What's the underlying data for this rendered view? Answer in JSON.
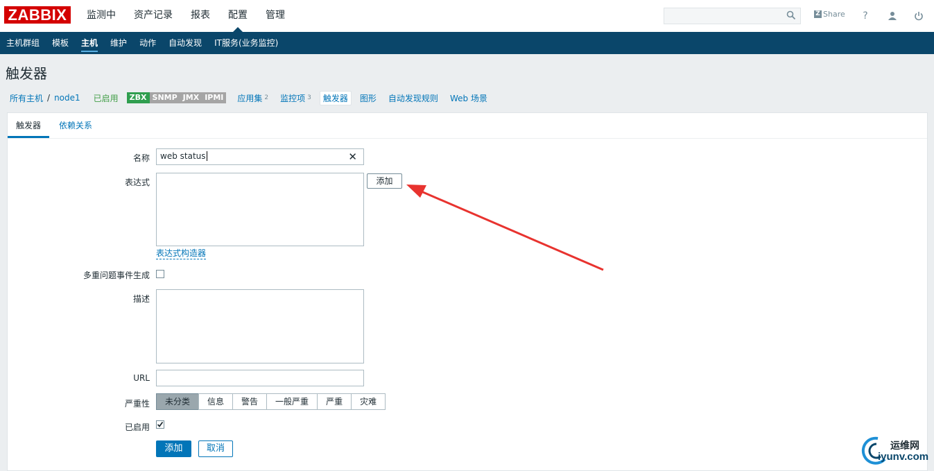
{
  "logo": "ZABBIX",
  "main_nav": [
    "监测中",
    "资产记录",
    "报表",
    "配置",
    "管理"
  ],
  "topbar": {
    "search_value": "",
    "share_label": "Share"
  },
  "sub_nav": [
    "主机群组",
    "模板",
    "主机",
    "维护",
    "动作",
    "自动发现",
    "IT服务(业务监控)"
  ],
  "page_title": "触发器",
  "breadcrumb": {
    "all_hosts": "所有主机",
    "sep": "/",
    "host": "node1",
    "status": "已启用",
    "tags": [
      "ZBX",
      "SNMP",
      "JMX",
      "IPMI"
    ],
    "items": [
      {
        "label": "应用集",
        "count": "2"
      },
      {
        "label": "监控项",
        "count": "3"
      },
      {
        "label": "触发器",
        "count": ""
      },
      {
        "label": "图形",
        "count": ""
      },
      {
        "label": "自动发现规则",
        "count": ""
      },
      {
        "label": "Web 场景",
        "count": ""
      }
    ]
  },
  "tabs": [
    "触发器",
    "依赖关系"
  ],
  "form": {
    "name_label": "名称",
    "name_value": "web status",
    "expression_label": "表达式",
    "add_expression_button": "添加",
    "expression_builder_link": "表达式构造器",
    "multiple_events_label": "多重问题事件生成",
    "description_label": "描述",
    "url_label": "URL",
    "severity_label": "严重性",
    "severities": [
      "未分类",
      "信息",
      "警告",
      "一般严重",
      "严重",
      "灾难"
    ],
    "selected_severity": "未分类",
    "enabled_label": "已启用",
    "submit_button": "添加",
    "cancel_button": "取消"
  },
  "watermark": {
    "cn": "运维网",
    "en": "iyunv.com"
  },
  "colors": {
    "brand": "#d40000",
    "nav": "#0a466a",
    "link": "#0275b8",
    "arrow": "#e8332f"
  }
}
